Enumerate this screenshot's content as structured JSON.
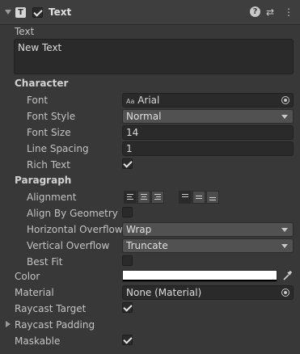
{
  "header": {
    "component_icon": "T",
    "title": "Text",
    "enabled": true,
    "help_icon": "?",
    "preset_icon": "⇄",
    "menu_icon": "⋮"
  },
  "text": {
    "label": "Text",
    "value": "New Text"
  },
  "character": {
    "section": "Character",
    "font_label": "Font",
    "font_icon": "Aa",
    "font_value": "Arial",
    "font_style_label": "Font Style",
    "font_style_value": "Normal",
    "font_size_label": "Font Size",
    "font_size_value": "14",
    "line_spacing_label": "Line Spacing",
    "line_spacing_value": "1",
    "rich_text_label": "Rich Text",
    "rich_text_checked": true
  },
  "paragraph": {
    "section": "Paragraph",
    "alignment_label": "Alignment",
    "align_by_geometry_label": "Align By Geometry",
    "align_by_geometry_checked": false,
    "horizontal_overflow_label": "Horizontal Overflow",
    "horizontal_overflow_value": "Wrap",
    "vertical_overflow_label": "Vertical Overflow",
    "vertical_overflow_value": "Truncate",
    "best_fit_label": "Best Fit",
    "best_fit_checked": false
  },
  "color": {
    "label": "Color",
    "value": "#ffffff"
  },
  "material": {
    "label": "Material",
    "value": "None (Material)"
  },
  "raycast_target": {
    "label": "Raycast Target",
    "checked": true
  },
  "raycast_padding": {
    "label": "Raycast Padding"
  },
  "maskable": {
    "label": "Maskable",
    "checked": true
  }
}
